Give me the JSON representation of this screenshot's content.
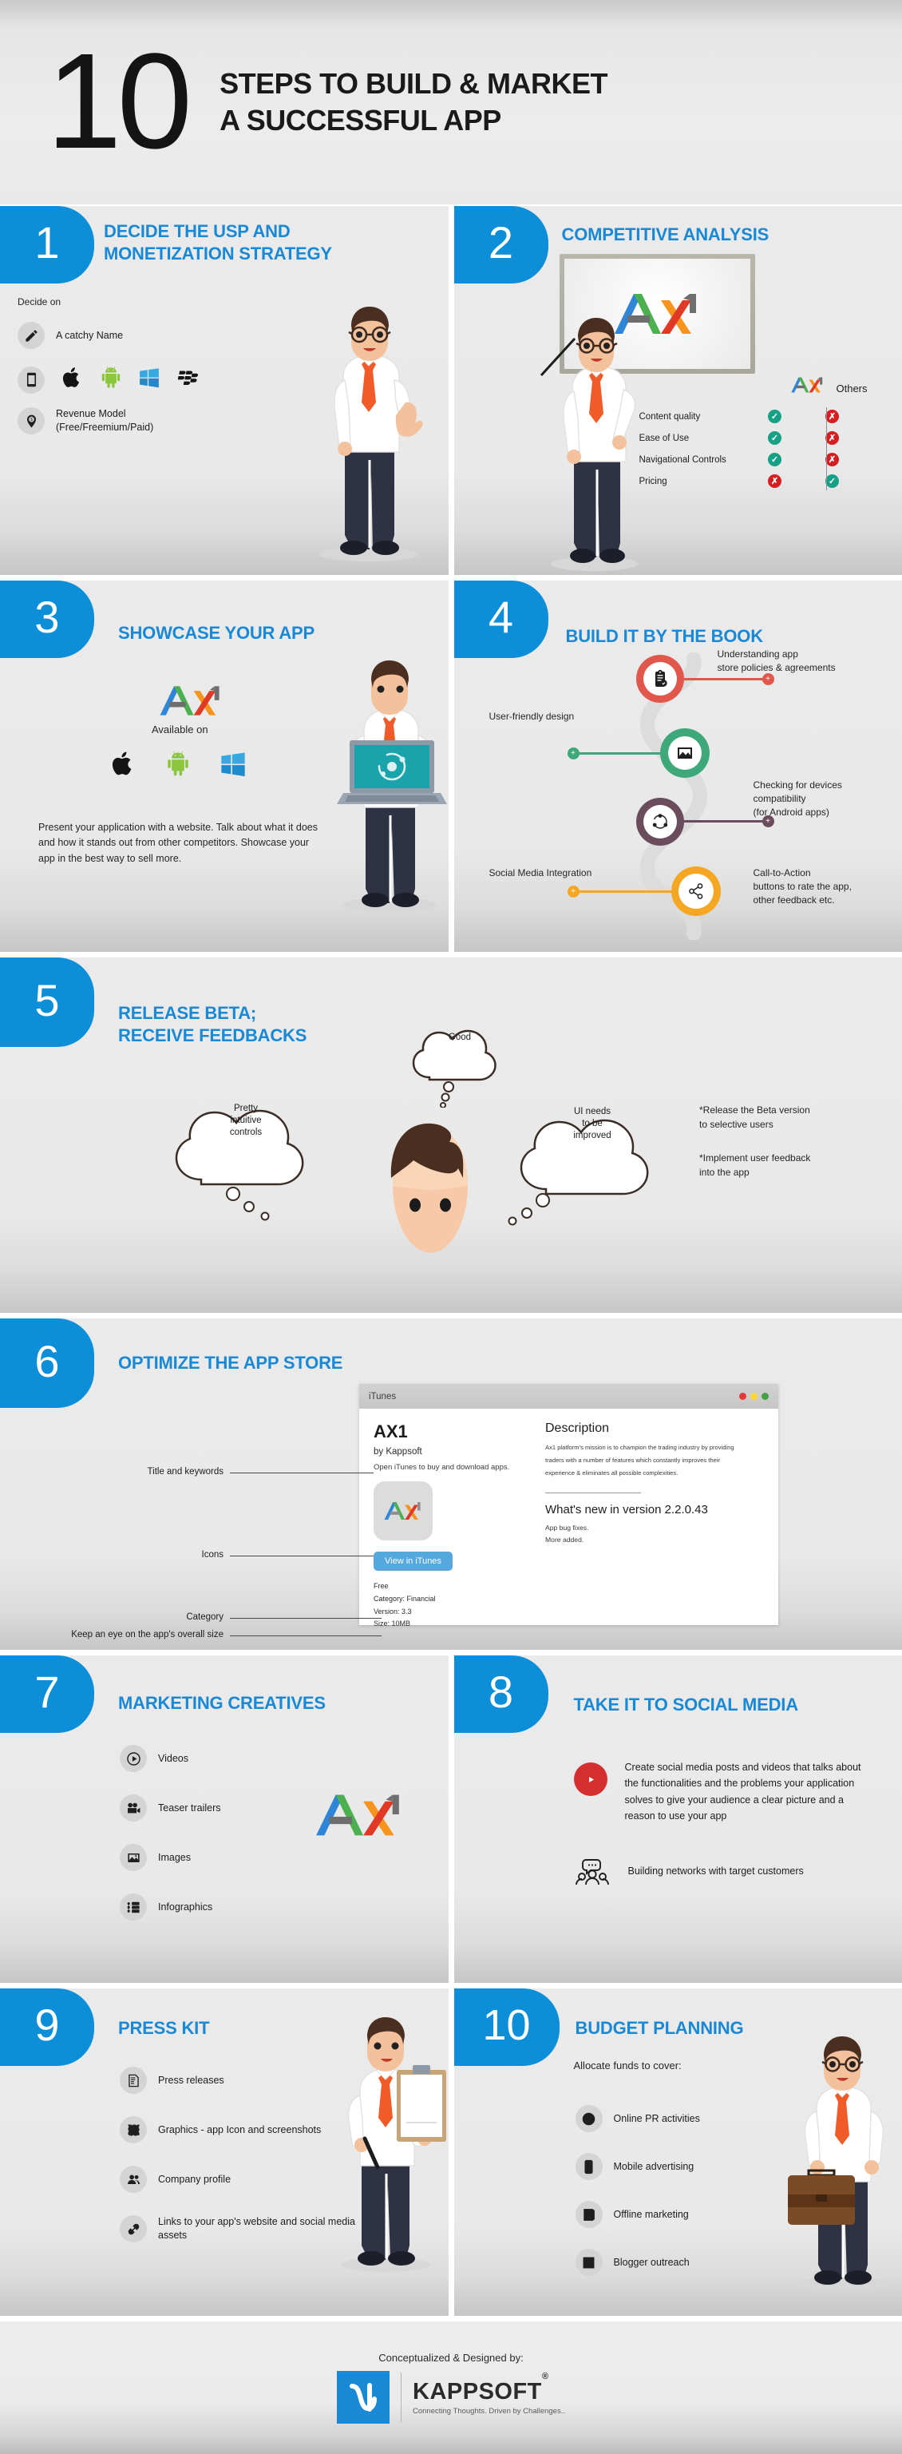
{
  "header": {
    "number": "10",
    "line1": "STEPS TO BUILD & MARKET",
    "line2": "A SUCCESSFUL APP"
  },
  "steps": [
    {
      "number": "1",
      "title_line1": "DECIDE THE USP AND",
      "title_line2": "MONETIZATION STRATEGY",
      "intro": "Decide on",
      "items": [
        {
          "icon": "pencil-icon",
          "label": "A catchy Name"
        },
        {
          "icon": "mobile-icon",
          "label": ""
        },
        {
          "icon": "revenue-pin-icon",
          "label": "Revenue Model\n(Free/Freemium/Paid)"
        }
      ],
      "revenue_label_line1": "Revenue Model",
      "revenue_label_line2": "(Free/Freemium/Paid)",
      "platforms": [
        "apple-icon",
        "android-icon",
        "windows-icon",
        "blackberry-icon"
      ]
    },
    {
      "number": "2",
      "title": "COMPETITIVE ANALYSIS",
      "board_logo": "AX1",
      "col_head_brand": "AX1",
      "col_head_others": "Others",
      "rows": [
        {
          "name": "Content quality",
          "ax1": "check",
          "others": "cross"
        },
        {
          "name": "Ease of Use",
          "ax1": "check",
          "others": "cross"
        },
        {
          "name": "Navigational Controls",
          "ax1": "check",
          "others": "cross"
        },
        {
          "name": "Pricing",
          "ax1": "cross",
          "others": "check"
        }
      ]
    },
    {
      "number": "3",
      "title": "SHOWCASE YOUR APP",
      "logo": "AX1",
      "available_on": "Available on",
      "platforms": [
        "apple-icon",
        "android-icon",
        "windows-icon"
      ],
      "body": "Present your application with a website. Talk about what it does and how it stands out from other competitors. Showcase your app in the best way to sell more."
    },
    {
      "number": "4",
      "title": "BUILD IT BY THE BOOK",
      "nodes": [
        {
          "icon": "clipboard-check-icon",
          "color": "#e2574c",
          "label": "Understanding app\nstore policies & agreements",
          "side": "right"
        },
        {
          "icon": "image-icon",
          "color": "#3fa87b",
          "label": "User-friendly design",
          "side": "left"
        },
        {
          "icon": "devices-network-icon",
          "color": "#6b4c5c",
          "label": "Checking for devices\ncompatibility\n(for Android apps)",
          "side": "right"
        },
        {
          "icon": "share-icon",
          "color": "#f5a623",
          "label": "Social Media Integration",
          "side": "left"
        }
      ],
      "label_policies_l1": "Understanding app",
      "label_policies_l2": "store policies & agreements",
      "label_userfriendly": "User-friendly design",
      "label_devices_l1": "Checking for devices",
      "label_devices_l2": "compatibility",
      "label_devices_l3": "(for Android apps)",
      "label_social": "Social Media Integration",
      "label_cta_l1": "Call-to-Action",
      "label_cta_l2": "buttons to rate the app,",
      "label_cta_l3": "other feedback etc."
    },
    {
      "number": "5",
      "title_line1": "RELEASE BETA;",
      "title_line2": "RECEIVE FEEDBACKS",
      "thoughts": {
        "top": "Good",
        "left_l1": "Pretty",
        "left_l2": "intuitive",
        "left_l3": "controls",
        "right_l1": "UI needs",
        "right_l2": "to be",
        "right_l3": "improved"
      },
      "note1_l1": "*Release the Beta version",
      "note1_l2": "to selective users",
      "note2_l1": "*Implement user feedback",
      "note2_l2": "into the app"
    },
    {
      "number": "6",
      "title": "OPTIMIZE THE APP STORE",
      "annotations": {
        "title_keywords": "Title and keywords",
        "icons": "Icons",
        "category": "Category",
        "size": "Keep an eye on the app's overall size"
      },
      "window": {
        "app_name": "iTunes",
        "app_title": "AX1",
        "author": "by Kappsoft",
        "open_line": "Open iTunes to buy and download apps.",
        "button": "View in iTunes",
        "price": "Free",
        "category": "Category: Financial",
        "version": "Version: 3.3",
        "size": "Size: 10MB",
        "desc_heading": "Description",
        "desc_l1": "Ax1 platform's mission is to champion the trading industry by providing",
        "desc_l2": "traders with a number of features which constantly improves their",
        "desc_l3": "experience & eliminates all possible complexities.",
        "whatsnew_heading": "What's new in version 2.2.0.43",
        "whatsnew_l1": "App bug fixes.",
        "whatsnew_l2": "More added."
      }
    },
    {
      "number": "7",
      "title": "MARKETING CREATIVES",
      "items": [
        {
          "icon": "play-circle-icon",
          "label": "Videos"
        },
        {
          "icon": "movie-camera-icon",
          "label": "Teaser trailers"
        },
        {
          "icon": "image-icon",
          "label": "Images"
        },
        {
          "icon": "infographic-icon",
          "label": "Infographics"
        }
      ],
      "logo": "AX1"
    },
    {
      "number": "8",
      "title": "TAKE IT TO SOCIAL MEDIA",
      "items": [
        {
          "icon": "youtube-icon",
          "label": "Create social media posts and videos that talks about the functionalities and the problems your application solves to give your audience a clear picture and a reason to use your app"
        },
        {
          "icon": "people-chat-icon",
          "label": "Building networks with target customers"
        }
      ]
    },
    {
      "number": "9",
      "title": "PRESS KIT",
      "items": [
        {
          "icon": "document-icon",
          "label": "Press releases"
        },
        {
          "icon": "crop-icon",
          "label": "Graphics - app Icon and screenshots"
        },
        {
          "icon": "people-icon",
          "label": "Company profile"
        },
        {
          "icon": "link-icon",
          "label": "Links to your app's website and social media assets"
        }
      ]
    },
    {
      "number": "10",
      "title": "BUDGET PLANNING",
      "intro": "Allocate funds to cover:",
      "items": [
        {
          "icon": "globe-icon",
          "label": "Online PR activities"
        },
        {
          "icon": "mobile-icon",
          "label": "Mobile advertising"
        },
        {
          "icon": "notepad-icon",
          "label": "Offline marketing"
        },
        {
          "icon": "blog-icon",
          "label": "Blogger outreach"
        }
      ]
    }
  ],
  "footer": {
    "credit": "Conceptualized & Designed by:",
    "brand": "KAPPSOFT",
    "registered": "®",
    "tagline": "Connecting Thoughts. Driven by Challenges.."
  },
  "colors": {
    "accent_blue": "#1989d6",
    "tab_blue": "#0c8ed9",
    "green_check": "#16a085",
    "red_cross": "#d61d20",
    "node_red": "#e2574c",
    "node_green": "#3fa87b",
    "node_purple": "#6b4c5c",
    "node_orange": "#f5a623",
    "panel_bg": "#eaeaea"
  }
}
